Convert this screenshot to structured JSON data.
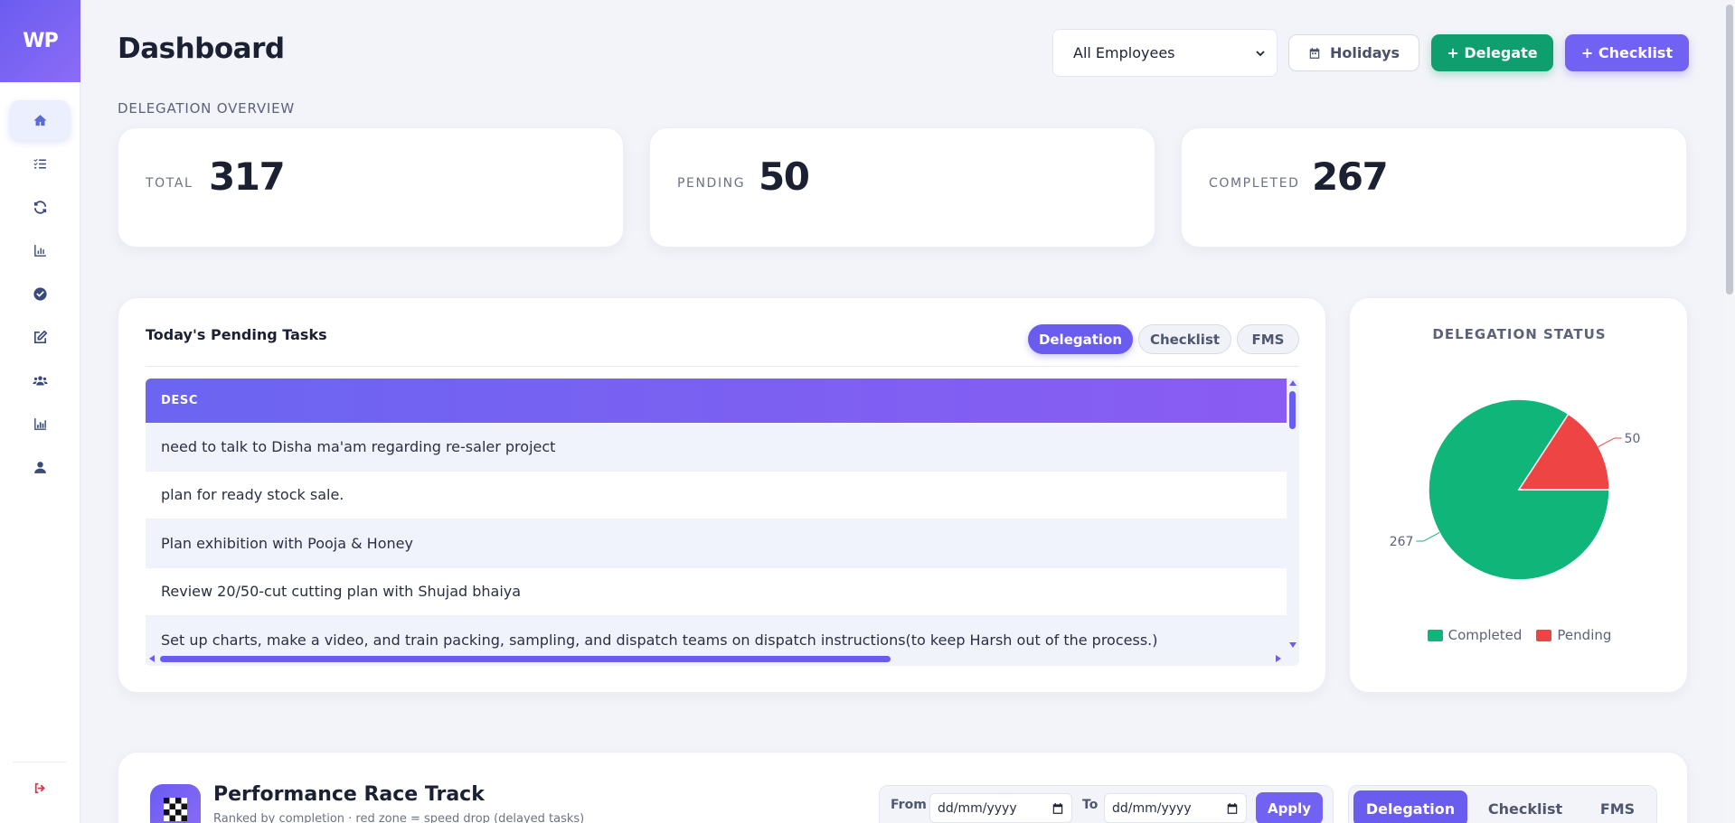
{
  "app": {
    "logo": "WP"
  },
  "header": {
    "title": "Dashboard",
    "employee_select": "All Employees",
    "holidays_label": "Holidays",
    "delegate_label": "+ Delegate",
    "checklist_label": "+ Checklist"
  },
  "sidebar": {
    "items": [
      {
        "icon": "home-icon",
        "active": true
      },
      {
        "icon": "list-check-icon",
        "active": false
      },
      {
        "icon": "refresh-icon",
        "active": false
      },
      {
        "icon": "bar-chart-icon",
        "active": false
      },
      {
        "icon": "check-circle-icon",
        "active": false
      },
      {
        "icon": "edit-icon",
        "active": false
      },
      {
        "icon": "users-icon",
        "active": false
      },
      {
        "icon": "stats-icon",
        "active": false
      },
      {
        "icon": "user-icon",
        "active": false
      }
    ],
    "logout_icon": "sign-out-icon"
  },
  "overview": {
    "label": "DELEGATION OVERVIEW",
    "total_label": "TOTAL",
    "total_value": "317",
    "pending_label": "PENDING",
    "pending_value": "50",
    "completed_label": "COMPLETED",
    "completed_value": "267"
  },
  "tasks": {
    "title": "Today's Pending Tasks",
    "tabs": [
      "Delegation",
      "Checklist",
      "FMS"
    ],
    "active_tab": "Delegation",
    "column": "DESC",
    "rows": [
      "need to talk to Disha ma'am regarding re-saler project",
      "plan for ready stock sale.",
      "Plan exhibition with Pooja & Honey",
      "Review 20/50-cut cutting plan with Shujad bhaiya",
      "Set up charts, make a video, and train packing, sampling, and dispatch teams on dispatch instructions(to keep Harsh out of the process.)"
    ]
  },
  "status": {
    "title": "DELEGATION STATUS"
  },
  "chart_data": {
    "type": "pie",
    "title": "DELEGATION STATUS",
    "categories": [
      "Completed",
      "Pending"
    ],
    "values": [
      267,
      50
    ],
    "colors": [
      "#10b57a",
      "#ef4444"
    ],
    "legend": "bottom"
  },
  "race": {
    "title": "Performance Race Track",
    "subtitle": "Ranked by completion · red zone = speed drop (delayed tasks)",
    "from_label": "From",
    "to_label": "To",
    "from_placeholder": "dd/mm/yyyy",
    "to_placeholder": "dd/mm/yyyy",
    "apply_label": "Apply",
    "tabs": [
      "Delegation",
      "Checklist",
      "FMS"
    ],
    "active_tab": "Delegation"
  },
  "colors": {
    "accent": "#6b5cf0",
    "delegate": "#0f9f6e",
    "completed": "#10b57a",
    "pending": "#ef4444"
  }
}
